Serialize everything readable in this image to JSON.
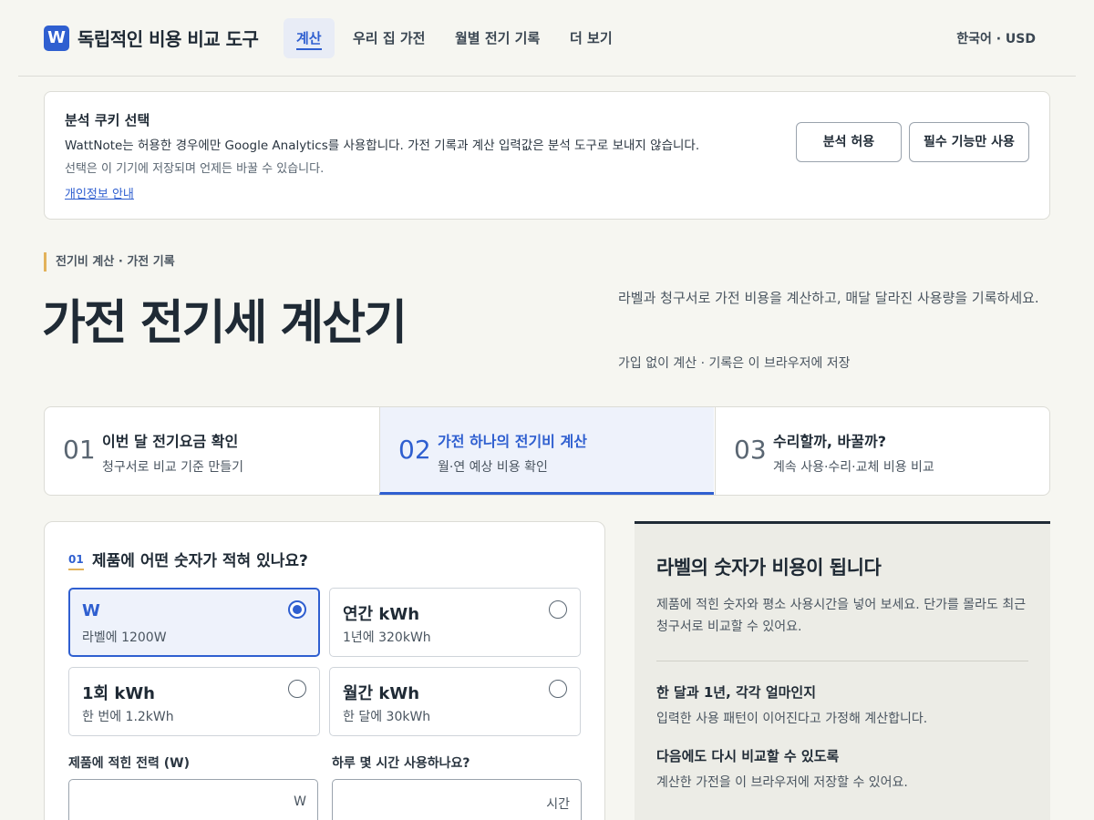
{
  "header": {
    "logo_letter": "W",
    "brand": "독립적인 비용 비교 도구",
    "nav": [
      {
        "label": "계산",
        "active": true
      },
      {
        "label": "우리 집 가전"
      },
      {
        "label": "월별 전기 기록"
      },
      {
        "label": "더 보기"
      }
    ],
    "locale": "한국어 · USD"
  },
  "cookie": {
    "title": "분석 쿠키 선택",
    "description": "WattNote는 허용한 경우에만 Google Analytics를 사용합니다. 가전 기록과 계산 입력값은 분석 도구로 보내지 않습니다.",
    "note": "선택은 이 기기에 저장되며 언제든 바꿀 수 있습니다.",
    "privacy_link": "개인정보 안내",
    "allow_label": "분석 허용",
    "essential_label": "필수 기능만 사용"
  },
  "hero": {
    "eyebrow": "전기비 계산 · 가전 기록",
    "title": "가전 전기세 계산기",
    "description": "라벨과 청구서로 가전 비용을 계산하고, 매달 달라진 사용량을 기록하세요.",
    "note": "가입 없이 계산 · 기록은 이 브라우저에 저장"
  },
  "steps": [
    {
      "num": "01",
      "title": "이번 달 전기요금 확인",
      "sub": "청구서로 비교 기준 만들기"
    },
    {
      "num": "02",
      "title": "가전 하나의 전기비 계산",
      "sub": "월·연 예상 비용 확인",
      "active": true
    },
    {
      "num": "03",
      "title": "수리할까, 바꿀까?",
      "sub": "계속 사용·수리·교체 비용 비교"
    }
  ],
  "form": {
    "question_num": "01",
    "question": "제품에 어떤 숫자가 적혀 있나요?",
    "options": [
      {
        "title": "W",
        "sub": "라벨에 1200W",
        "selected": true
      },
      {
        "title": "연간 kWh",
        "sub": "1년에 320kWh"
      },
      {
        "title": "1회 kWh",
        "sub": "한 번에 1.2kWh"
      },
      {
        "title": "월간 kWh",
        "sub": "한 달에 30kWh"
      }
    ],
    "power_label": "제품에 적힌 전력 (W)",
    "power_unit": "W",
    "power_value": "",
    "hours_label": "하루 몇 시간 사용하나요?",
    "hours_unit": "시간",
    "hours_value": ""
  },
  "info": {
    "title": "라벨의 숫자가 비용이 됩니다",
    "description": "제품에 적힌 숫자와 평소 사용시간을 넣어 보세요. 단가를 몰라도 최근 청구서로 비교할 수 있어요.",
    "point1_title": "한 달과 1년, 각각 얼마인지",
    "point1_desc": "입력한 사용 패턴이 이어진다고 가정해 계산합니다.",
    "point2_title": "다음에도 다시 비교할 수 있도록",
    "point2_desc": "계산한 가전을 이 브라우저에 저장할 수 있어요."
  }
}
